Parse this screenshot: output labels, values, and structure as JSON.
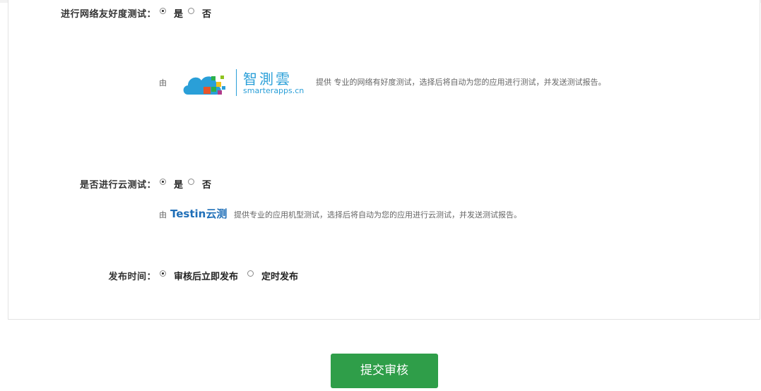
{
  "network_test": {
    "label": "进行网络友好度测试：",
    "option_yes": "是",
    "option_no": "否",
    "selected": "yes",
    "provider_prefix": "由",
    "provider_logo_cn": "智測雲",
    "provider_logo_en": "smarterapps.cn",
    "description": "提供 专业的网络有好度测试，选择后将自动为您的应用进行测试，并发送测试报告。"
  },
  "cloud_test": {
    "label": "是否进行云测试：",
    "option_yes": "是",
    "option_no": "否",
    "selected": "yes",
    "provider_prefix": "由",
    "provider_logo": "Testin云测",
    "description": "提供专业的应用机型测试，选择后将自动为您的应用进行云测试，并发送测试报告。"
  },
  "publish_time": {
    "label": "发布时间：",
    "option_immediate": "审核后立即发布",
    "option_scheduled": "定时发布",
    "selected": "immediate"
  },
  "submit_button": "提交审核",
  "colors": {
    "button": "#2f9e49",
    "testin_blue": "#1f6fb8",
    "smarterapps_blue": "#2a9fd8"
  }
}
